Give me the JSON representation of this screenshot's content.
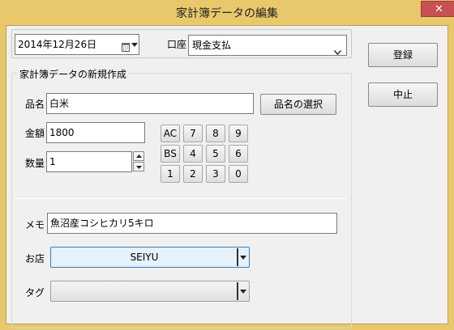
{
  "window": {
    "title": "家計簿データの編集",
    "close_glyph": "✕"
  },
  "date_picker": {
    "value": "2014年12月26日",
    "icon": "calendar-icon"
  },
  "account": {
    "label": "口座",
    "value": "現金支払"
  },
  "side_buttons": {
    "register": "登録",
    "cancel": "中止"
  },
  "section": {
    "legend": "家計簿データの新規作成"
  },
  "item": {
    "label": "品名",
    "value": "白米",
    "select_button": "品名の選択"
  },
  "amount": {
    "label": "金額",
    "value": "1800"
  },
  "quantity": {
    "label": "数量",
    "value": "1"
  },
  "keypad": {
    "rows": [
      [
        "AC",
        "7",
        "8",
        "9"
      ],
      [
        "BS",
        "4",
        "5",
        "6"
      ],
      [
        "1",
        "2",
        "3",
        "0"
      ]
    ]
  },
  "memo": {
    "label": "メモ",
    "value": "魚沼産コシヒカリ5キロ"
  },
  "shop": {
    "label": "お店",
    "value": "SEIYU"
  },
  "tag": {
    "label": "タグ",
    "value": ""
  }
}
